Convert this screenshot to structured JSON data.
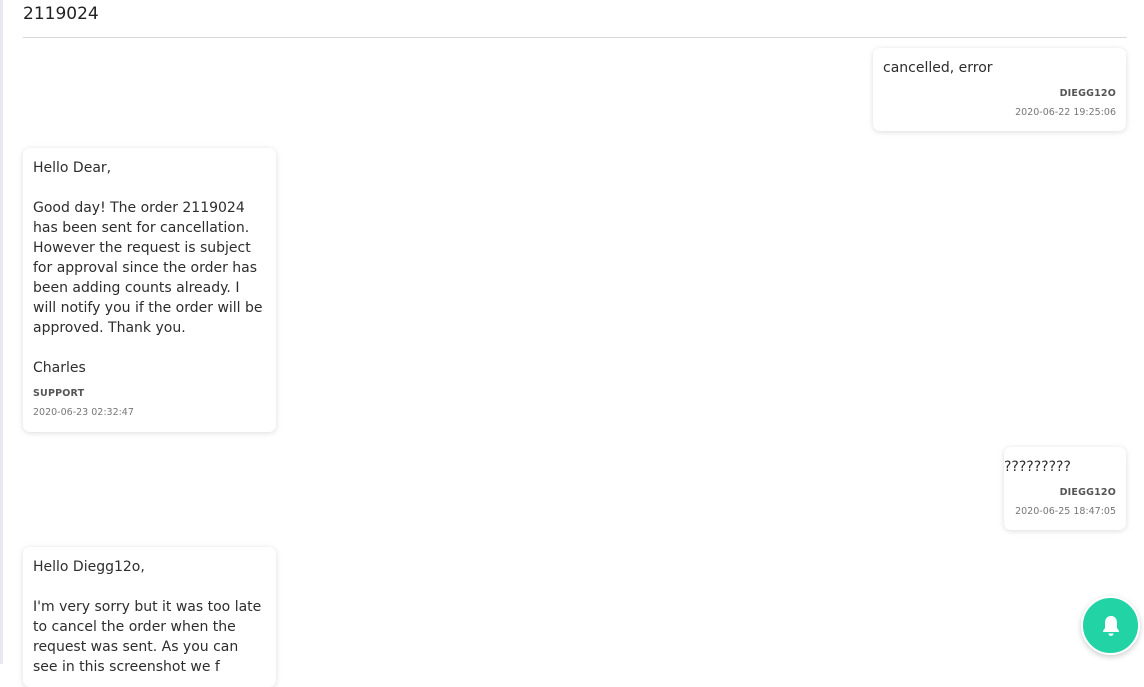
{
  "ticket": {
    "title": "2119024"
  },
  "messages": [
    {
      "side": "right",
      "body": "cancelled, error",
      "author": "DIEGG12O",
      "time": "2020-06-22 19:25:06"
    },
    {
      "side": "left",
      "body": "Hello Dear,\n\nGood day! The order 2119024 has been sent for cancellation. However the request is subject for approval since the order has been adding counts already. I will notify you if the order will be approved. Thank you.\n\nCharles",
      "author": "SUPPORT",
      "time": "2020-06-23 02:32:47"
    },
    {
      "side": "right",
      "body": "?????????",
      "author": "DIEGG12O",
      "time": "2020-06-25 18:47:05"
    },
    {
      "side": "left",
      "body": "Hello Diegg12o,\n\nI'm very sorry but it was too late to cancel the order when the request was sent. As you can see in this screenshot we f",
      "author": "",
      "time": ""
    }
  ],
  "notify": {
    "icon": "bell-icon",
    "color": "#22d3a6"
  }
}
